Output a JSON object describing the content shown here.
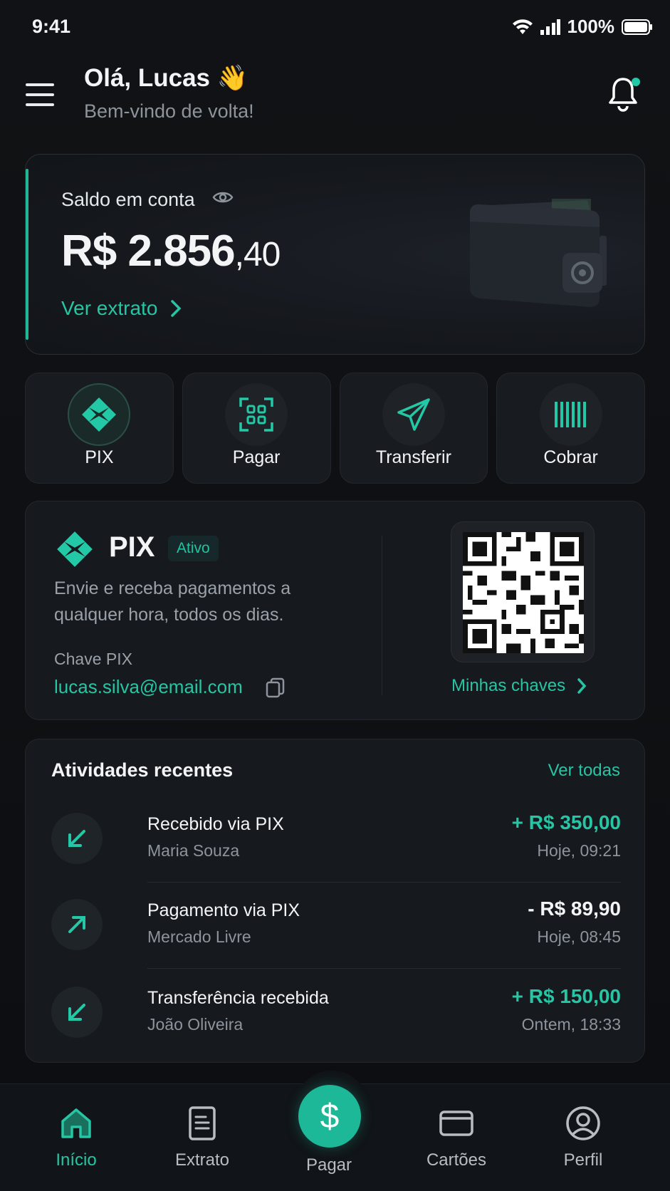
{
  "status": {
    "time": "9:41",
    "battery": "100%"
  },
  "header": {
    "greeting": "Olá, Lucas 👋",
    "subtitle": "Bem-vindo de volta!"
  },
  "balance": {
    "label": "Saldo em conta",
    "amount_main": "R$ 2.856",
    "amount_cents": ",40",
    "link": "Ver extrato"
  },
  "actions": [
    {
      "label": "PIX",
      "icon": "pix-icon"
    },
    {
      "label": "Pagar",
      "icon": "scan-icon"
    },
    {
      "label": "Transferir",
      "icon": "send-icon"
    },
    {
      "label": "Cobrar",
      "icon": "barcode-icon"
    }
  ],
  "pix": {
    "title": "PIX",
    "badge": "Ativo",
    "description": "Envie e receba pagamentos a qualquer hora, todos os dias.",
    "key_label": "Chave PIX",
    "key_value": "lucas.silva@email.com",
    "my_keys": "Minhas chaves"
  },
  "activities": {
    "title": "Atividades recentes",
    "see_all": "Ver todas",
    "items": [
      {
        "title": "Recebido via PIX",
        "name": "Maria Souza",
        "amount": "+ R$ 350,00",
        "when": "Hoje, 09:21",
        "type": "in"
      },
      {
        "title": "Pagamento via PIX",
        "name": "Mercado Livre",
        "amount": "- R$ 89,90",
        "when": "Hoje, 08:45",
        "type": "out"
      },
      {
        "title": "Transferência recebida",
        "name": "João Oliveira",
        "amount": "+ R$ 150,00",
        "when": "Ontem, 18:33",
        "type": "in"
      }
    ]
  },
  "nav": {
    "home": "Início",
    "statement": "Extrato",
    "pay": "Pagar",
    "cards": "Cartões",
    "profile": "Perfil",
    "pay_symbol": "$"
  },
  "colors": {
    "accent": "#1fb896",
    "background": "#0d0f12",
    "card": "#16191e"
  }
}
